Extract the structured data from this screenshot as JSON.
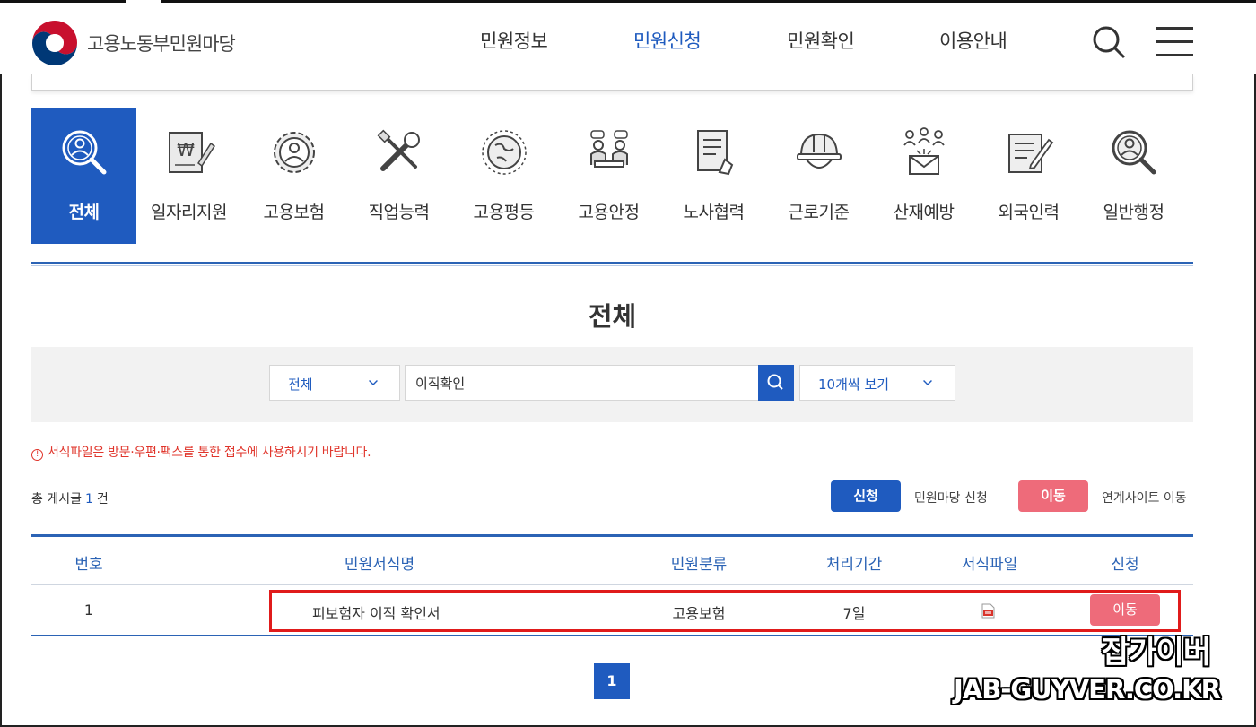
{
  "header": {
    "logo_text": "고용노동부민원마당",
    "nav": [
      "민원정보",
      "민원신청",
      "민원확인",
      "이용안내"
    ],
    "nav_active": "민원신청"
  },
  "categories": [
    {
      "label": "전체",
      "icon": "search-person-icon",
      "active": true
    },
    {
      "label": "일자리지원",
      "icon": "won-document-icon"
    },
    {
      "label": "고용보험",
      "icon": "gear-person-icon"
    },
    {
      "label": "직업능력",
      "icon": "tools-icon"
    },
    {
      "label": "고용평등",
      "icon": "globe-icon"
    },
    {
      "label": "고용안정",
      "icon": "meeting-icon"
    },
    {
      "label": "노사협력",
      "icon": "document-hand-icon"
    },
    {
      "label": "근로기준",
      "icon": "helmet-icon"
    },
    {
      "label": "산재예방",
      "icon": "mail-people-icon"
    },
    {
      "label": "외국인력",
      "icon": "document-pen-icon"
    },
    {
      "label": "일반행정",
      "icon": "search-person-icon"
    }
  ],
  "page_title": "전체",
  "search": {
    "category_value": "전체",
    "query": "이직확인",
    "page_size_value": "10개씩 보기"
  },
  "notice": "서식파일은 방문·우편·팩스를 통한 접수에 사용하시기 바랍니다.",
  "total": {
    "prefix": "총 게시글",
    "count": "1",
    "suffix": "건"
  },
  "legend": {
    "apply_btn": "신청",
    "apply_text": "민원마당 신청",
    "move_btn": "이동",
    "move_text": "연계사이트 이동"
  },
  "table": {
    "headers": [
      "번호",
      "민원서식명",
      "민원분류",
      "처리기간",
      "서식파일",
      "신청"
    ],
    "rows": [
      {
        "no": "1",
        "name": "피보험자 이직 확인서",
        "category": "고용보험",
        "period": "7일",
        "file_icon": "hwp-file-icon",
        "action": "이동"
      }
    ]
  },
  "pagination": {
    "current": "1"
  },
  "watermark": {
    "line1": "잡가이버",
    "line2": "JAB-GUYVER.CO.KR"
  },
  "colors": {
    "primary": "#1f5bbf",
    "accent_pink": "#ee6b7a",
    "notice_red": "#e0352b",
    "highlight_red": "#e01b1b"
  }
}
